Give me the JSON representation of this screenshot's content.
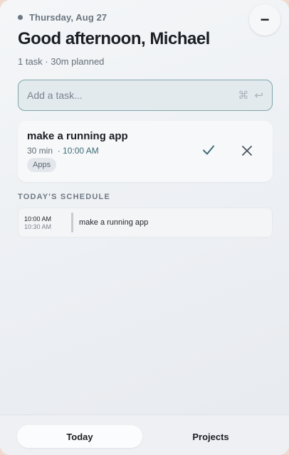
{
  "header": {
    "date": "Thursday, Aug 27",
    "greeting": "Good afternoon, Michael",
    "summary": "1 task · 30m planned",
    "minimize_label": "−"
  },
  "add_task": {
    "placeholder": "Add a task...",
    "shortcut_cmd": "⌘",
    "shortcut_enter": "↩"
  },
  "task": {
    "title": "make a running app",
    "duration": "30 min",
    "separator": "·",
    "time": "10:00 AM",
    "tag": "Apps"
  },
  "schedule": {
    "label": "TODAY'S SCHEDULE",
    "items": [
      {
        "start": "10:00 AM",
        "end": "10:30 AM",
        "title": "make a running app"
      }
    ]
  },
  "tabs": [
    {
      "label": "Today",
      "active": true
    },
    {
      "label": "Projects",
      "active": false
    }
  ],
  "colors": {
    "accent": "#3d6e76",
    "input_border": "#7fa6ab"
  }
}
